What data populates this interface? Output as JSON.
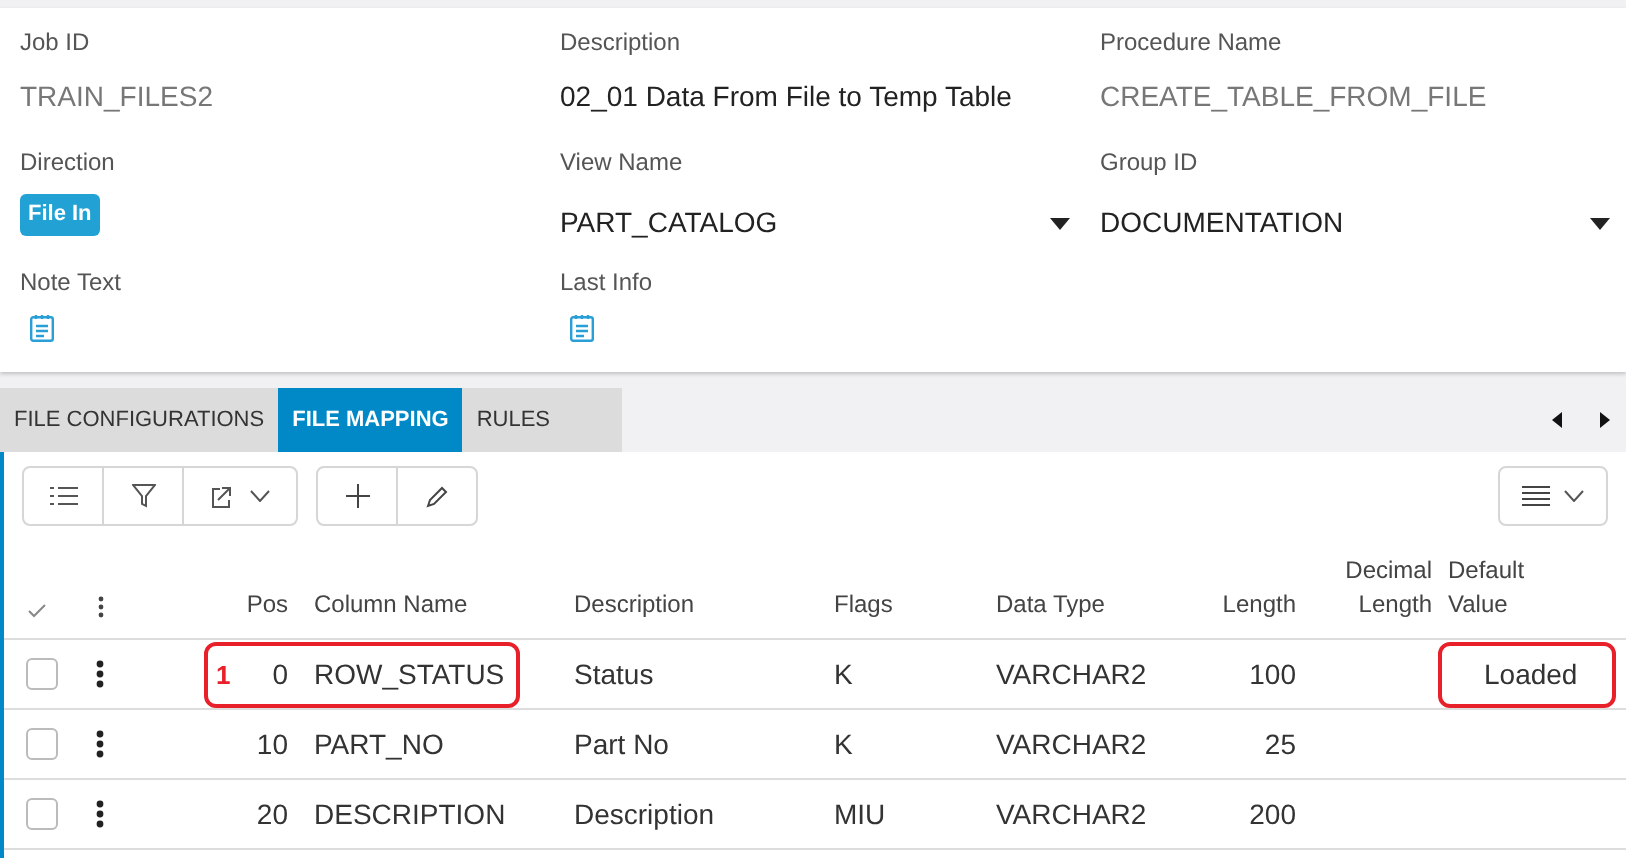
{
  "fields": [
    {
      "label": "Job ID",
      "kind": "readonly",
      "value": "TRAIN_FILES2"
    },
    {
      "label": "Description",
      "kind": "text",
      "value": "02_01 Data From File to Temp Table"
    },
    {
      "label": "Procedure Name",
      "kind": "readonly",
      "value": "CREATE_TABLE_FROM_FILE"
    },
    {
      "label": "Direction",
      "kind": "badge",
      "value": "File In"
    },
    {
      "label": "View Name",
      "kind": "dropdown",
      "value": "PART_CATALOG"
    },
    {
      "label": "Group ID",
      "kind": "dropdown",
      "value": "DOCUMENTATION"
    },
    {
      "label": "Note Text",
      "kind": "note"
    },
    {
      "label": "Last Info",
      "kind": "note"
    }
  ],
  "tabs": [
    {
      "label": "FILE CONFIGURATIONS",
      "selected": false
    },
    {
      "label": "FILE MAPPING",
      "selected": true
    },
    {
      "label": "RULES",
      "selected": false
    }
  ],
  "table": {
    "columns": [
      "Pos",
      "Column Name",
      "Description",
      "Flags",
      "Data Type",
      "Length",
      "Decimal Length",
      "Default Value"
    ],
    "rows": [
      {
        "checked": false,
        "cells": [
          "0",
          "ROW_STATUS",
          "Status",
          "K",
          "VARCHAR2",
          "100",
          "",
          "Loaded"
        ],
        "annotation": {
          "marker": "1",
          "highlight_name": true,
          "highlight_default": true
        }
      },
      {
        "checked": false,
        "cells": [
          "10",
          "PART_NO",
          "Part No",
          "K",
          "VARCHAR2",
          "25",
          "",
          ""
        ]
      },
      {
        "checked": false,
        "cells": [
          "20",
          "DESCRIPTION",
          "Description",
          "MIU",
          "VARCHAR2",
          "200",
          "",
          ""
        ]
      }
    ]
  }
}
